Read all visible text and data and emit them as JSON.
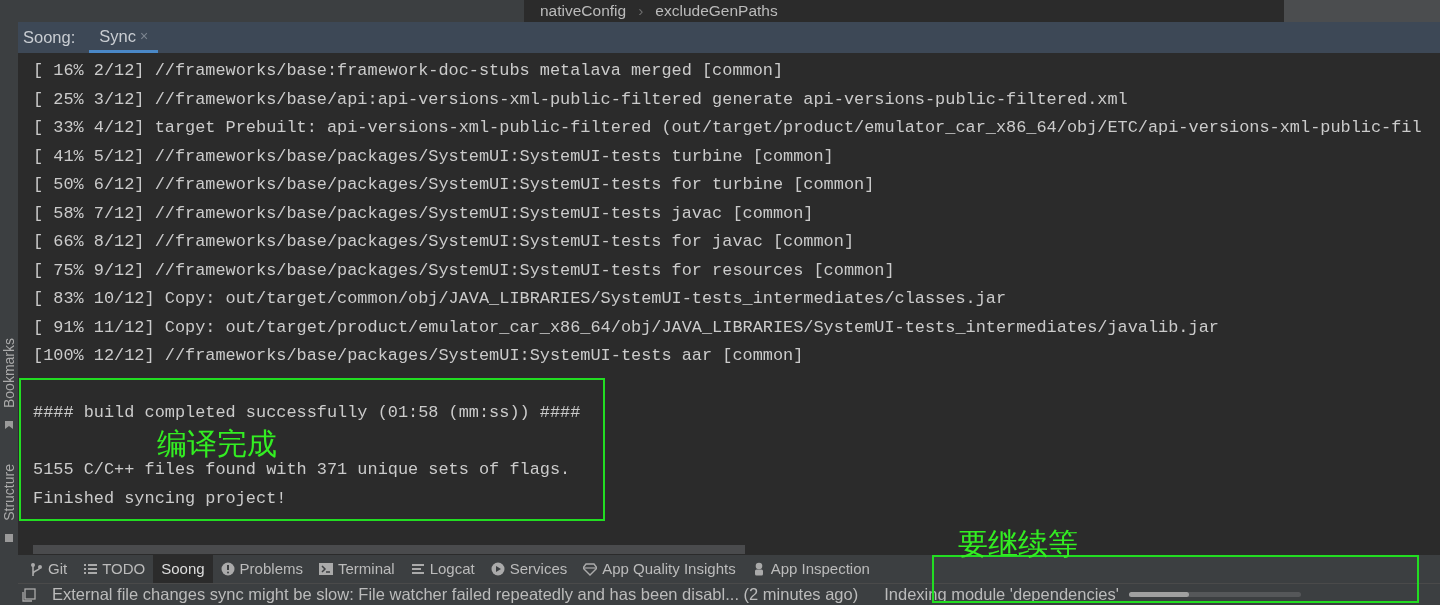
{
  "breadcrumb": [
    {
      "label": "nativeConfig"
    },
    {
      "label": "excludeGenPaths"
    }
  ],
  "breadcrumb_separator": "›",
  "panel": {
    "title": "Soong:",
    "tabs": [
      {
        "label": "Sync",
        "selected": true,
        "close": "×"
      }
    ]
  },
  "console": {
    "lines": [
      {
        "text": "[ 16% 2/12] //frameworks/base:framework-doc-stubs metalava merged [common]"
      },
      {
        "text": "[ 25% 3/12] //frameworks/base/api:api-versions-xml-public-filtered generate api-versions-public-filtered.xml"
      },
      {
        "text": "[ 33% 4/12] target Prebuilt: api-versions-xml-public-filtered (out/target/product/emulator_car_x86_64/obj/ETC/api-versions-xml-public-fil"
      },
      {
        "text": "[ 41% 5/12] //frameworks/base/packages/SystemUI:SystemUI-tests turbine [common]"
      },
      {
        "text": "[ 50% 6/12] //frameworks/base/packages/SystemUI:SystemUI-tests for turbine [common]"
      },
      {
        "text": "[ 58% 7/12] //frameworks/base/packages/SystemUI:SystemUI-tests javac [common]"
      },
      {
        "text": "[ 66% 8/12] //frameworks/base/packages/SystemUI:SystemUI-tests for javac [common]"
      },
      {
        "text": "[ 75% 9/12] //frameworks/base/packages/SystemUI:SystemUI-tests for resources [common]"
      },
      {
        "text": "[ 83% 10/12] Copy: out/target/common/obj/JAVA_LIBRARIES/SystemUI-tests_intermediates/classes.jar"
      },
      {
        "text": "[ 91% 11/12] Copy: out/target/product/emulator_car_x86_64/obj/JAVA_LIBRARIES/SystemUI-tests_intermediates/javalib.jar"
      },
      {
        "text": "[100% 12/12] //frameworks/base/packages/SystemUI:SystemUI-tests aar [common]"
      },
      {
        "text": "#### build completed successfully (01:58 (mm:ss)) ####",
        "gap_before": true
      },
      {
        "text": "5155 C/C++ files found with 371 unique sets of flags.",
        "gap_before": true
      },
      {
        "text": "Finished syncing project!"
      }
    ]
  },
  "side_toolbar": [
    {
      "label": "Bookmarks"
    },
    {
      "label": "Structure"
    }
  ],
  "tool_windows": [
    {
      "label": "Git",
      "kind": "branch",
      "selected": false
    },
    {
      "label": "TODO",
      "kind": "list",
      "selected": false
    },
    {
      "label": "Soong",
      "kind": "plain",
      "selected": true
    },
    {
      "label": "Problems",
      "kind": "alert",
      "selected": false
    },
    {
      "label": "Terminal",
      "kind": "terminal",
      "selected": false
    },
    {
      "label": "Logcat",
      "kind": "lines",
      "selected": false
    },
    {
      "label": "Services",
      "kind": "play",
      "selected": false
    },
    {
      "label": "App Quality Insights",
      "kind": "diamond",
      "selected": false
    },
    {
      "label": "App Inspection",
      "kind": "figure",
      "selected": false
    }
  ],
  "status_bar": {
    "message": "External file changes sync might be slow: File watcher failed repeatedly and has been disabl... (2 minutes ago)",
    "progress": {
      "label": "Indexing module 'dependencies'",
      "level": 0.35
    }
  },
  "annotations": [
    {
      "text": "编译完成"
    },
    {
      "text": "要继续等"
    }
  ]
}
